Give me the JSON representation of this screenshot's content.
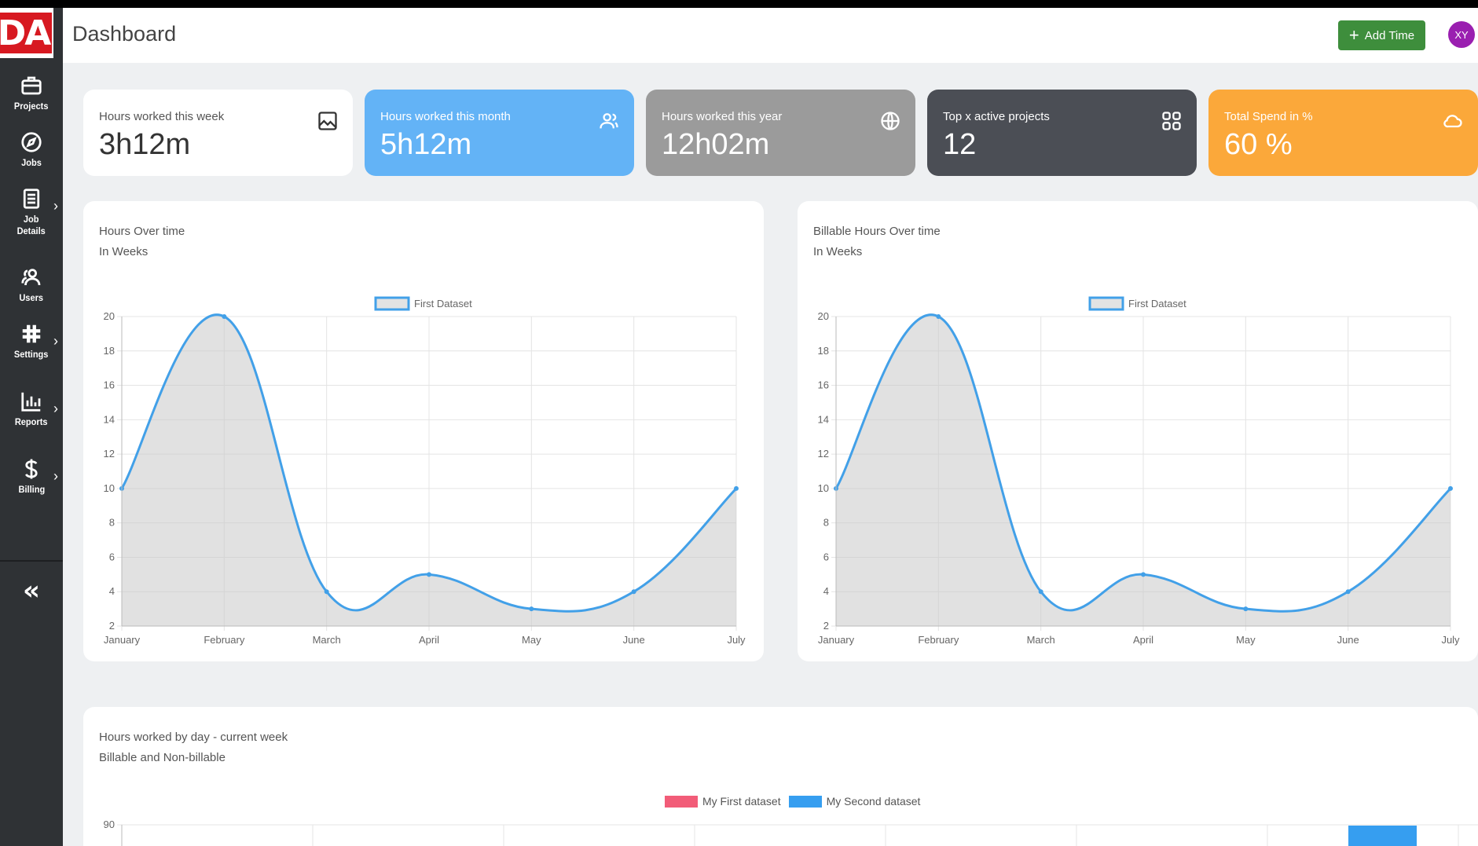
{
  "app": {
    "title": "Dashboard",
    "logo_text": "DA"
  },
  "header": {
    "add_time_label": "Add Time",
    "avatar_initials": "XY",
    "accent": "#3e8e3c",
    "avatar_color": "#9a1fb0"
  },
  "sidebar": {
    "items": [
      {
        "label": "Projects",
        "icon": "briefcase-icon",
        "has_submenu": false
      },
      {
        "label": "Jobs",
        "icon": "compass-icon",
        "has_submenu": false
      },
      {
        "label": "Job\nDetails",
        "icon": "document-icon",
        "has_submenu": true
      },
      {
        "label": "Users",
        "icon": "users-icon",
        "has_submenu": false
      },
      {
        "label": "Settings",
        "icon": "hash-settings-icon",
        "has_submenu": true
      },
      {
        "label": "Reports",
        "icon": "bar-chart-icon",
        "has_submenu": true
      },
      {
        "label": "Billing",
        "icon": "dollar-icon",
        "has_submenu": true
      }
    ],
    "collapse_glyph": "«"
  },
  "stats": [
    {
      "label": "Hours worked this week",
      "value": "3h12m",
      "icon": "image-icon",
      "color": "#ffffff"
    },
    {
      "label": "Hours worked this month",
      "value": "5h12m",
      "icon": "users-icon",
      "color": "#63b3f6"
    },
    {
      "label": "Hours worked this year",
      "value": "12h02m",
      "icon": "globe-icon",
      "color": "#9b9b9b"
    },
    {
      "label": "Top x active projects",
      "value": "12",
      "icon": "grid-icon",
      "color": "#4b4e55"
    },
    {
      "label": "Total Spend in %",
      "value": "60 %",
      "icon": "cloud-icon",
      "color": "#fba83a"
    }
  ],
  "charts": {
    "hours_over_time": {
      "title": "Hours Over time",
      "subtitle": "In Weeks"
    },
    "billable_hours_over_time": {
      "title": "Billable Hours Over time",
      "subtitle": "In Weeks"
    },
    "hours_by_day": {
      "title": "Hours worked by day - current week",
      "subtitle": "Billable and Non-billable"
    }
  },
  "chart_data": [
    {
      "type": "area",
      "title": "Hours Over time",
      "subtitle": "In Weeks",
      "categories": [
        "January",
        "February",
        "March",
        "April",
        "May",
        "June",
        "July"
      ],
      "series": [
        {
          "name": "First Dataset",
          "values": [
            10,
            20,
            4,
            5,
            3,
            4,
            10
          ],
          "color": "#42a0e8"
        }
      ],
      "ylim": [
        2,
        20
      ],
      "yticks": [
        2,
        4,
        6,
        8,
        10,
        12,
        14,
        16,
        18,
        20
      ],
      "grid": true,
      "legend": "top-center"
    },
    {
      "type": "area",
      "title": "Billable Hours Over time",
      "subtitle": "In Weeks",
      "categories": [
        "January",
        "February",
        "March",
        "April",
        "May",
        "June",
        "July"
      ],
      "series": [
        {
          "name": "First Dataset",
          "values": [
            10,
            20,
            4,
            5,
            3,
            4,
            10
          ],
          "color": "#42a0e8"
        }
      ],
      "ylim": [
        2,
        20
      ],
      "yticks": [
        2,
        4,
        6,
        8,
        10,
        12,
        14,
        16,
        18,
        20
      ],
      "grid": true,
      "legend": "top-center"
    },
    {
      "type": "bar",
      "title": "Hours worked by day - current week",
      "subtitle": "Billable and Non-billable",
      "series": [
        {
          "name": "My First dataset",
          "color": "#f25c78"
        },
        {
          "name": "My Second dataset",
          "color": "#369ef0"
        }
      ],
      "yticks_visible": [
        90
      ],
      "legend": "top-center"
    }
  ]
}
